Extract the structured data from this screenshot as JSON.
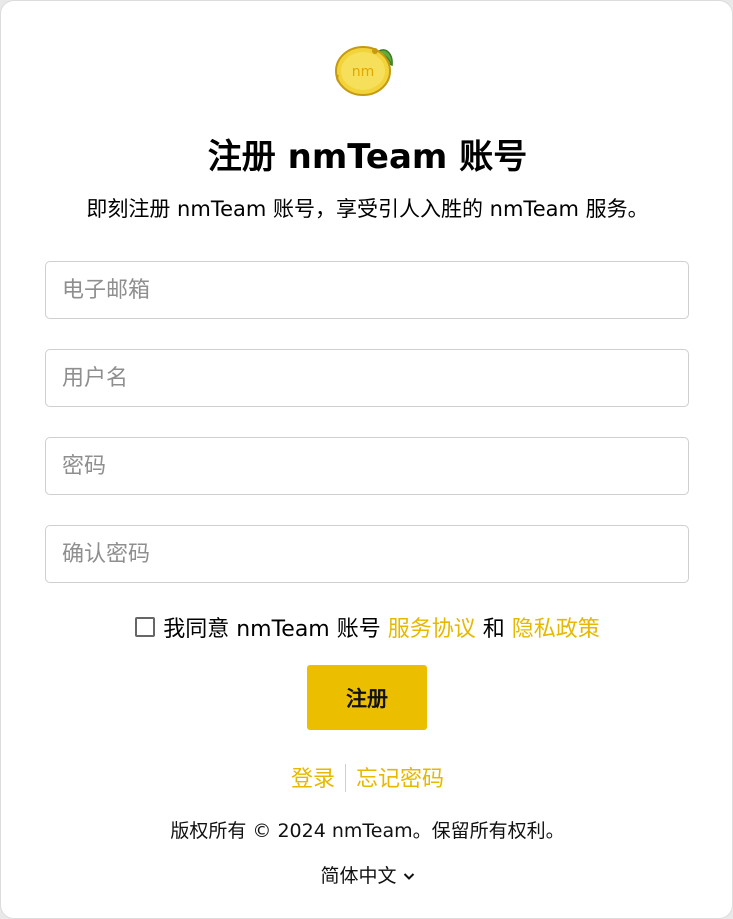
{
  "brand": {
    "logo_text": "nm",
    "accent_color": "#ebbf00",
    "link_color": "#e6b800"
  },
  "header": {
    "title": "注册 nmTeam 账号",
    "subtitle": "即刻注册 nmTeam 账号，享受引人入胜的 nmTeam 服务。"
  },
  "form": {
    "email_placeholder": "电子邮箱",
    "username_placeholder": "用户名",
    "password_placeholder": "密码",
    "confirm_placeholder": "确认密码",
    "agree_text": "我同意 nmTeam 账号",
    "terms_link": "服务协议",
    "and_text": "和",
    "privacy_link": "隐私政策",
    "submit_label": "注册"
  },
  "links": {
    "login": "登录",
    "forgot": "忘记密码"
  },
  "footer": {
    "copyright": "版权所有 © 2024 nmTeam。保留所有权利。",
    "language": "简体中文",
    "language_icon": "chevron-down-icon"
  }
}
